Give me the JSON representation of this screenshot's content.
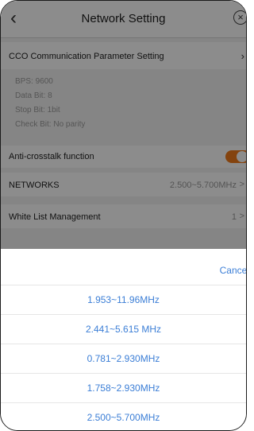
{
  "header": {
    "back_icon": "‹",
    "title": "Network Setting",
    "close_icon": "×"
  },
  "cco": {
    "label": "CCO Communication Parameter Setting",
    "chevron": "›"
  },
  "params": {
    "bps": "BPS: 9600",
    "data_bit": "Data Bit: 8",
    "stop_bit": "Stop Bit: 1bit",
    "check_bit": "Check Bit: No parity"
  },
  "anti_crosstalk": {
    "label": "Anti-crosstalk function",
    "enabled": true
  },
  "networks": {
    "label": "NETWORKS",
    "value": "2.500~5.700MHz",
    "chevron": ">"
  },
  "white_list": {
    "label": "White List Management",
    "value": "1",
    "chevron": ">"
  },
  "sheet": {
    "cancel_label": "Cancel",
    "options": [
      "1.953~11.96MHz",
      "2.441~5.615 MHz",
      "0.781~2.930MHz",
      "1.758~2.930MHz",
      "2.500~5.700MHz"
    ]
  },
  "colors": {
    "accent": "#3b7ed6",
    "toggle": "#f07b1b",
    "dim_overlay": "rgba(0,0,0,0.45)"
  }
}
